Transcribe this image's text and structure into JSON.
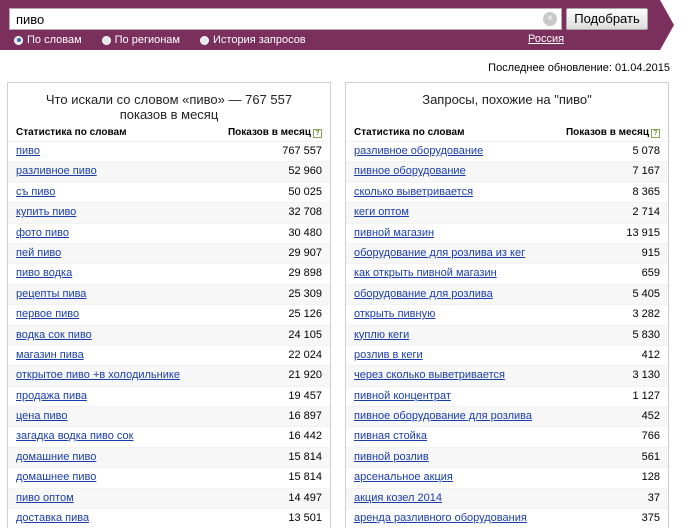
{
  "search": {
    "query": "пиво",
    "submit_label": "Подобрать",
    "clear_glyph": "×"
  },
  "modes": [
    {
      "label": "По словам",
      "selected": true
    },
    {
      "label": "По регионам",
      "selected": false
    },
    {
      "label": "История запросов",
      "selected": false
    }
  ],
  "region": "Россия",
  "last_update": "Последнее обновление: 01.04.2015",
  "colors": {
    "band": "#7a2f5c",
    "link": "#1a3daa"
  },
  "left_panel": {
    "title_line1": "Что искали со словом «пиво» — 767 557",
    "title_line2": "показов в месяц",
    "col_words": "Статистика по словам",
    "col_shows": "Показов в месяц",
    "rows": [
      {
        "phrase": "пиво",
        "count": "767 557"
      },
      {
        "phrase": "разливное пиво",
        "count": "52 960"
      },
      {
        "phrase": "съ пиво",
        "count": "50 025"
      },
      {
        "phrase": "купить пиво",
        "count": "32 708"
      },
      {
        "phrase": "фото пиво",
        "count": "30 480"
      },
      {
        "phrase": "пей пиво",
        "count": "29 907"
      },
      {
        "phrase": "пиво водка",
        "count": "29 898"
      },
      {
        "phrase": "рецепты пива",
        "count": "25 309"
      },
      {
        "phrase": "первое пиво",
        "count": "25 126"
      },
      {
        "phrase": "водка сок пиво",
        "count": "24 105"
      },
      {
        "phrase": "магазин пива",
        "count": "22 024"
      },
      {
        "phrase": "открытое пиво +в холодильнике",
        "count": "21 920"
      },
      {
        "phrase": "продажа пива",
        "count": "19 457"
      },
      {
        "phrase": "цена пиво",
        "count": "16 897"
      },
      {
        "phrase": "загадка водка пиво сок",
        "count": "16 442"
      },
      {
        "phrase": "домашние пиво",
        "count": "15 814"
      },
      {
        "phrase": "домашнее пиво",
        "count": "15 814"
      },
      {
        "phrase": "пиво оптом",
        "count": "14 497"
      },
      {
        "phrase": "доставка пива",
        "count": "13 501"
      }
    ]
  },
  "right_panel": {
    "title_line1": "Запросы, похожие на \"пиво\"",
    "col_words": "Статистика по словам",
    "col_shows": "Показов в месяц",
    "rows": [
      {
        "phrase": "разливное оборудование",
        "count": "5 078"
      },
      {
        "phrase": "пивное оборудование",
        "count": "7 167"
      },
      {
        "phrase": "сколько выветривается",
        "count": "8 365"
      },
      {
        "phrase": "кеги оптом",
        "count": "2 714"
      },
      {
        "phrase": "пивной магазин",
        "count": "13 915"
      },
      {
        "phrase": "оборудование для розлива из кег",
        "count": "915"
      },
      {
        "phrase": "как открыть пивной магазин",
        "count": "659"
      },
      {
        "phrase": "оборудование для розлива",
        "count": "5 405"
      },
      {
        "phrase": "открыть пивную",
        "count": "3 282"
      },
      {
        "phrase": "куплю кеги",
        "count": "5 830"
      },
      {
        "phrase": "розлив в кеги",
        "count": "412"
      },
      {
        "phrase": "через сколько выветривается",
        "count": "3 130"
      },
      {
        "phrase": "пивной концентрат",
        "count": "1 127"
      },
      {
        "phrase": "пивное оборудование для розлива",
        "count": "452"
      },
      {
        "phrase": "пивная стойка",
        "count": "766"
      },
      {
        "phrase": "пивной розлив",
        "count": "561"
      },
      {
        "phrase": "арсенальное акция",
        "count": "128"
      },
      {
        "phrase": "акция козел 2014",
        "count": "37"
      },
      {
        "phrase": "аренда разливного оборудования",
        "count": "375"
      }
    ]
  }
}
